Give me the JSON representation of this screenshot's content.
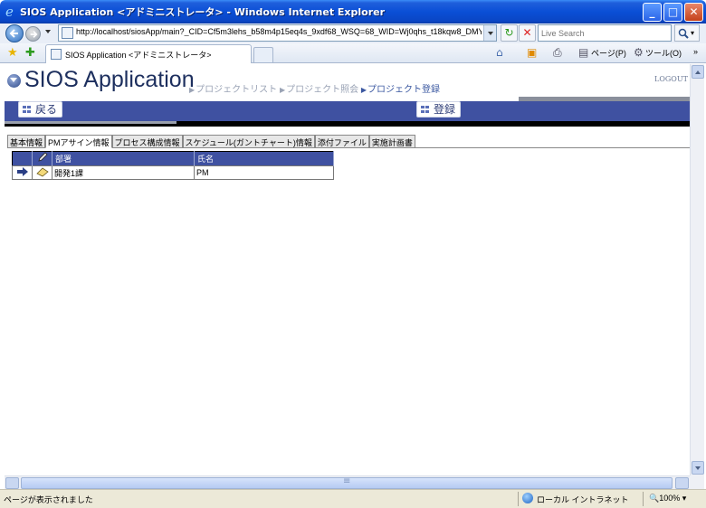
{
  "window": {
    "title": "SIOS Application <アドミニストレータ> - Windows Internet Explorer"
  },
  "address": {
    "url": "http://localhost/siosApp/main?_CID=Cf5m3lehs_b58m4p15eq4s_9xdf68_WSQ=68_WID=Wj0qhs_t18kqw8_DMY=13Cf5r",
    "search_placeholder": "Live Search"
  },
  "browser_tab": {
    "label": "SIOS Application <アドミニストレータ>"
  },
  "command_bar": {
    "page_label": "ページ(P)",
    "tools_label": "ツール(O)"
  },
  "app": {
    "title": "SIOS Application",
    "logout": "LOGOUT",
    "breadcrumbs": [
      {
        "label": "プロジェクトリスト"
      },
      {
        "label": "プロジェクト照会"
      },
      {
        "label": "プロジェクト登録"
      }
    ],
    "back_label": "戻る",
    "register_label": "登録"
  },
  "tabs": [
    {
      "label": "基本情報"
    },
    {
      "label": "PMアサイン情報"
    },
    {
      "label": "プロセス構成情報"
    },
    {
      "label": "スケジュール(ガントチャート)情報"
    },
    {
      "label": "添付ファイル"
    },
    {
      "label": "実施計画書"
    }
  ],
  "table": {
    "headers": [
      "部署",
      "氏名"
    ],
    "rows": [
      {
        "department": "開発1課",
        "name": "PM"
      }
    ]
  },
  "status": {
    "text": "ページが表示されました",
    "zone": "ローカル イントラネット",
    "zoom": "100%"
  },
  "colors": {
    "app_blue": "#3f51a1",
    "title_bar": "#0a4fd6"
  }
}
